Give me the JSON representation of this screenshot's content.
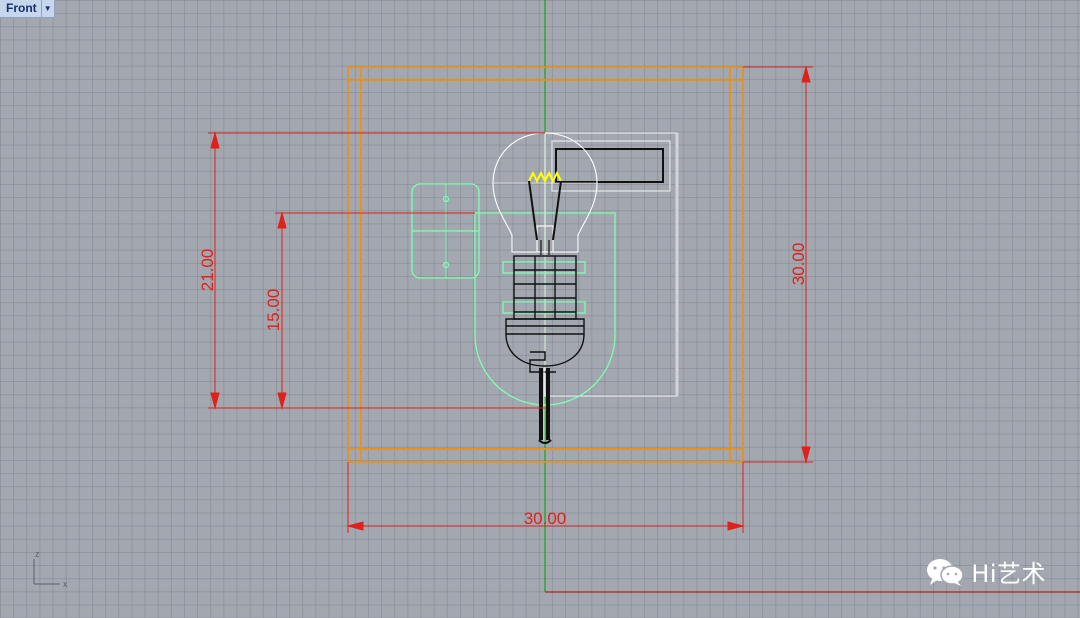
{
  "viewport": {
    "name": "Front",
    "dropdown_icon": "chevron-down-icon",
    "background": "#a3a8b0"
  },
  "dimensions": {
    "top_height": "21.00",
    "inner_height": "15.00",
    "overall_height": "30.00",
    "overall_width": "30.00"
  },
  "axis_widget": {
    "up": "z",
    "right": "x"
  },
  "watermark": {
    "text": "Hi艺术",
    "icon": "wechat-icon"
  },
  "colors": {
    "frame": "#f0900e",
    "dimension": "#e0201a",
    "bracket": "#7dffb0",
    "filament": "#ffff00",
    "y_axis": "#1aa31a",
    "x_axis": "#b4231e",
    "bulb": "#ffffff"
  }
}
